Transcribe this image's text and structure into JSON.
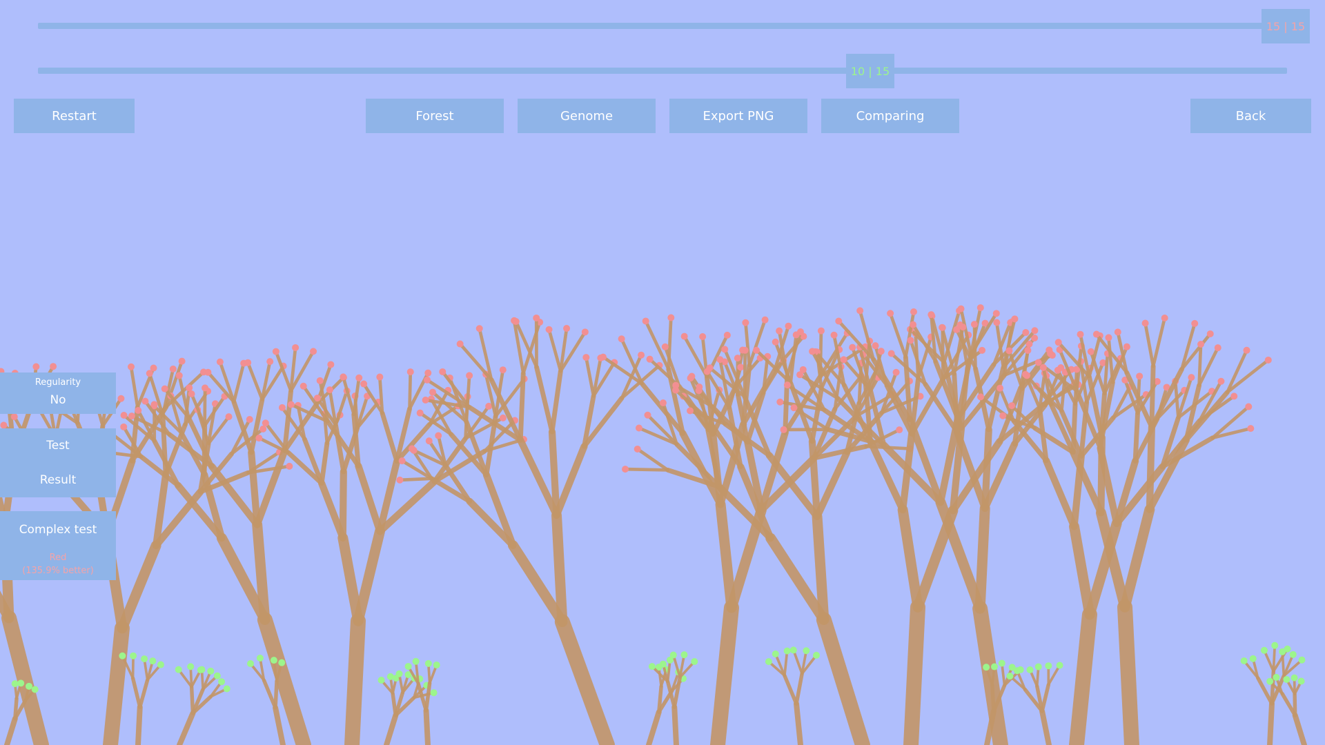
{
  "sliders": [
    {
      "label": "15 | 15",
      "value": 15,
      "max": 15,
      "color": "#f4a3a8"
    },
    {
      "label": "10 | 15",
      "value": 10,
      "max": 15,
      "color": "#9cf58c"
    }
  ],
  "toolbar": {
    "restart": "Restart",
    "forest": "Forest",
    "genome": "Genome",
    "export_png": "Export PNG",
    "comparing": "Comparing",
    "back": "Back"
  },
  "panel": {
    "regularity_title": "Regularity",
    "regularity_value": "No",
    "test": "Test",
    "result": "Result",
    "complex_test": "Complex test",
    "complex_result_line1": "Red",
    "complex_result_line2": "(135.9% better)"
  },
  "colors": {
    "background": "#afbefc",
    "ui": "#8fb4e8",
    "trunk": "#c39668",
    "leaf_red": "#f28f92",
    "leaf_green": "#9cf58c"
  }
}
